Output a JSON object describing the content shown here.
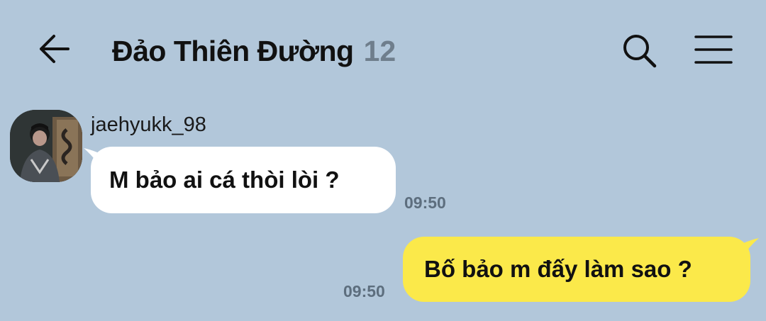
{
  "header": {
    "title": "Đảo Thiên Đường",
    "member_count": "12",
    "back_icon": "arrow-left-icon",
    "search_icon": "search-icon",
    "menu_icon": "hamburger-menu-icon"
  },
  "messages": [
    {
      "direction": "incoming",
      "sender": "jaehyukk_98",
      "text": "M bảo ai cá thòi lòi ?",
      "time": "09:50"
    },
    {
      "direction": "outgoing",
      "text": "Bố bảo m đấy làm sao ?",
      "time": "09:50"
    }
  ],
  "colors": {
    "background": "#b2c7da",
    "incoming_bubble": "#ffffff",
    "outgoing_bubble": "#fbe94a",
    "timestamp": "#5d6e7e",
    "member_count": "#6f7e8c"
  }
}
